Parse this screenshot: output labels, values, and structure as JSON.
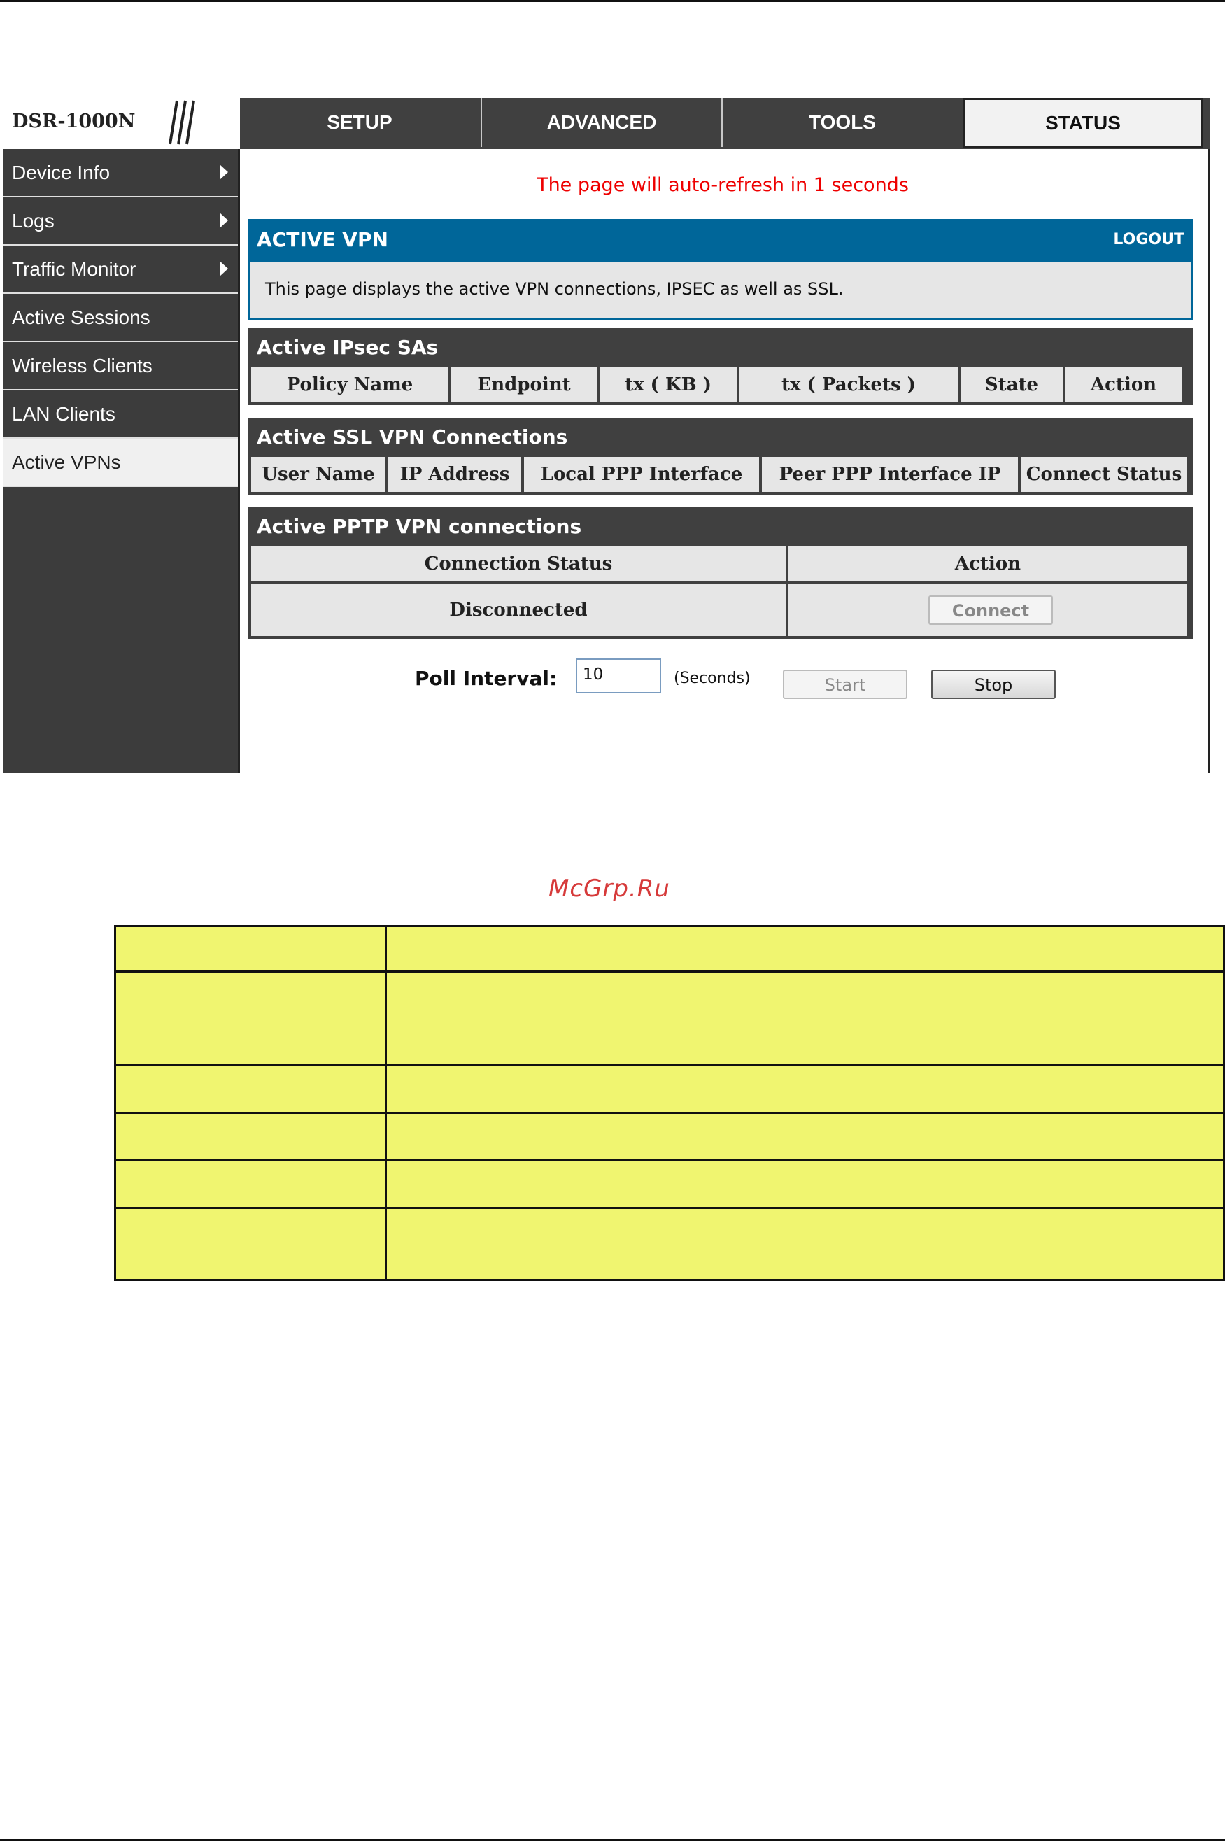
{
  "brand": {
    "model": "DSR-1000N"
  },
  "topnav": {
    "tabs": [
      {
        "label": "SETUP"
      },
      {
        "label": "ADVANCED"
      },
      {
        "label": "TOOLS"
      },
      {
        "label": "STATUS",
        "active": true
      }
    ]
  },
  "sidebar": {
    "items": [
      {
        "label": "Device Info",
        "submenu": true
      },
      {
        "label": "Logs",
        "submenu": true
      },
      {
        "label": "Traffic Monitor",
        "submenu": true
      },
      {
        "label": "Active Sessions"
      },
      {
        "label": "Wireless Clients"
      },
      {
        "label": "LAN Clients"
      },
      {
        "label": "Active VPNs",
        "active": true
      }
    ]
  },
  "main": {
    "refresh_notice": "The page will auto-refresh in 1 seconds",
    "panel_title": "ACTIVE VPN",
    "logout": "LOGOUT",
    "description": "This page displays the active VPN connections, IPSEC as well as SSL.",
    "ipsec": {
      "title": "Active IPsec SAs",
      "columns": [
        "Policy Name",
        "Endpoint",
        "tx ( KB )",
        "tx ( Packets )",
        "State",
        "Action"
      ]
    },
    "ssl": {
      "title": "Active SSL VPN Connections",
      "columns": [
        "User Name",
        "IP Address",
        "Local PPP Interface",
        "Peer PPP Interface IP",
        "Connect Status"
      ]
    },
    "pptp": {
      "title": "Active PPTP VPN connections",
      "columns": [
        "Connection Status",
        "Action"
      ],
      "status": "Disconnected",
      "connect_button": "Connect"
    },
    "poll": {
      "label": "Poll Interval:",
      "value": "10",
      "unit": "(Seconds)",
      "start_button": "Start",
      "stop_button": "Stop"
    }
  },
  "watermark": "McGrp.Ru",
  "colors": {
    "panel_blue": "#006699",
    "nav_dark": "#404040",
    "refresh_red": "#e00000",
    "table_yellow": "#f0f570"
  }
}
